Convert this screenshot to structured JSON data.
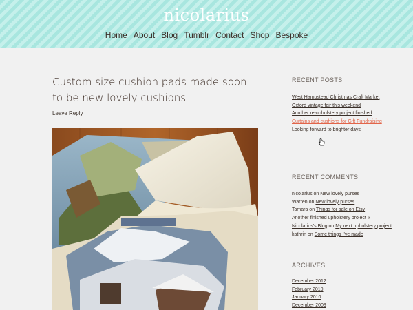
{
  "site": {
    "title": "nicolarius"
  },
  "nav": [
    "Home",
    "About",
    "Blog",
    "Tumblr",
    "Contact",
    "Shop",
    "Bespoke"
  ],
  "post": {
    "title": "Custom size cushion pads made soon to be new lovely cushions",
    "leave_reply": "Leave Reply",
    "image_alt": "needlepoint tapestry alpine scene with cushion pad"
  },
  "sidebar": {
    "recent_posts": {
      "title": "RECENT POSTS",
      "items": [
        "West Hampstead Christmas Craft Market",
        "Oxford vintage fair this weekend",
        "Another re-upholstery project finished",
        "Curtains and cushions for Gift Fundraising",
        "Looking forward to brighter days"
      ]
    },
    "recent_comments": {
      "title": "RECENT COMMENTS",
      "items": [
        {
          "author": "nicolarius",
          "on": "on",
          "link": "New lovely purses"
        },
        {
          "author": "Warren",
          "on": "on",
          "link": "New lovely purses"
        },
        {
          "author": "Tamara",
          "on": "on",
          "link": "Things for sale on Etsy"
        },
        {
          "author": "Another finished upholstery project « Nicolarius's Blog",
          "on": "on",
          "link": "My next upholstery project"
        },
        {
          "author": "kathrin",
          "on": "on",
          "link": "Some things I've made"
        }
      ]
    },
    "archives": {
      "title": "ARCHIVES",
      "items": [
        "December 2012",
        "February 2010",
        "January 2010",
        "December 2009"
      ]
    }
  },
  "colors": {
    "header": "#a8e6df",
    "link_hover": "#e2654a",
    "background": "#f1f1f1"
  }
}
